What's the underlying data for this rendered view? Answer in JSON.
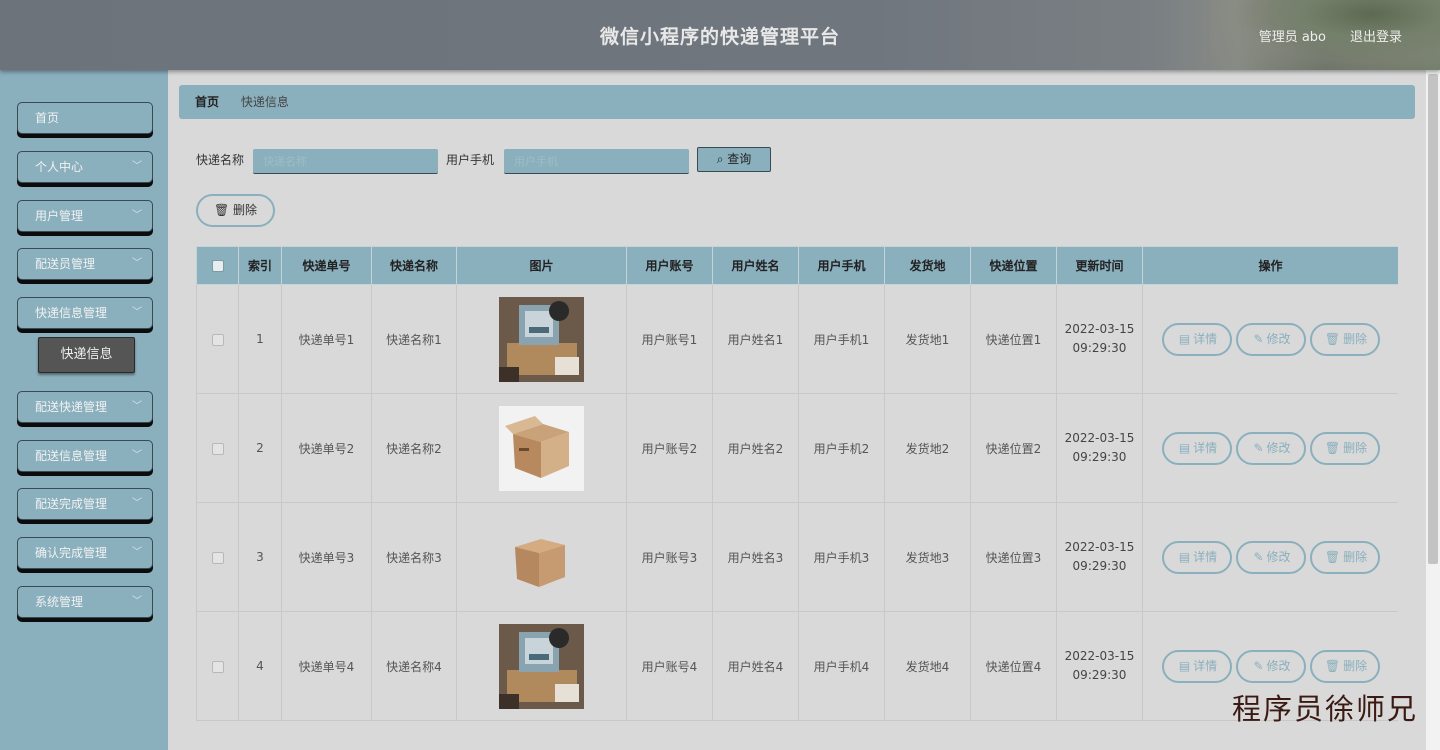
{
  "header": {
    "title": "微信小程序的快递管理平台",
    "user": "管理员 abo",
    "logout": "退出登录"
  },
  "sidebar": {
    "items": [
      {
        "label": "首页",
        "has_arrow": false
      },
      {
        "label": "个人中心",
        "has_arrow": true
      },
      {
        "label": "用户管理",
        "has_arrow": true
      },
      {
        "label": "配送员管理",
        "has_arrow": true
      },
      {
        "label": "快递信息管理",
        "has_arrow": true
      },
      {
        "label": "配送快递管理",
        "has_arrow": true
      },
      {
        "label": "配送信息管理",
        "has_arrow": true
      },
      {
        "label": "配送完成管理",
        "has_arrow": true
      },
      {
        "label": "确认完成管理",
        "has_arrow": true
      },
      {
        "label": "系统管理",
        "has_arrow": true
      }
    ],
    "active_sub": "快递信息"
  },
  "breadcrumb": {
    "home": "首页",
    "current": "快递信息"
  },
  "search": {
    "name_label": "快递名称",
    "name_placeholder": "快递名称",
    "phone_label": "用户手机",
    "phone_placeholder": "用户手机",
    "query": "查询"
  },
  "delete_label": "删除",
  "table": {
    "headers": [
      "索引",
      "快递单号",
      "快递名称",
      "图片",
      "用户账号",
      "用户姓名",
      "用户手机",
      "发货地",
      "快递位置",
      "更新时间",
      "操作"
    ],
    "rows": [
      {
        "idx": "1",
        "no": "快递单号1",
        "name": "快递名称1",
        "img": "parcel-photo",
        "account": "用户账号1",
        "uname": "用户姓名1",
        "phone": "用户手机1",
        "from": "发货地1",
        "loc": "快递位置1",
        "date": "2022-03-15",
        "time": "09:29:30"
      },
      {
        "idx": "2",
        "no": "快递单号2",
        "name": "快递名称2",
        "img": "open-box",
        "account": "用户账号2",
        "uname": "用户姓名2",
        "phone": "用户手机2",
        "from": "发货地2",
        "loc": "快递位置2",
        "date": "2022-03-15",
        "time": "09:29:30"
      },
      {
        "idx": "3",
        "no": "快递单号3",
        "name": "快递名称3",
        "img": "closed-box",
        "account": "用户账号3",
        "uname": "用户姓名3",
        "phone": "用户手机3",
        "from": "发货地3",
        "loc": "快递位置3",
        "date": "2022-03-15",
        "time": "09:29:30"
      },
      {
        "idx": "4",
        "no": "快递单号4",
        "name": "快递名称4",
        "img": "parcel-photo",
        "account": "用户账号4",
        "uname": "用户姓名4",
        "phone": "用户手机4",
        "from": "发货地4",
        "loc": "快递位置4",
        "date": "2022-03-15",
        "time": "09:29:30"
      }
    ],
    "ops": {
      "detail": "详情",
      "edit": "修改",
      "del": "删除"
    }
  },
  "watermark": "程序员徐师兄",
  "colors": {
    "accent": "#8aafbd",
    "header": "#6d737b",
    "background": "#d9d9d9"
  }
}
